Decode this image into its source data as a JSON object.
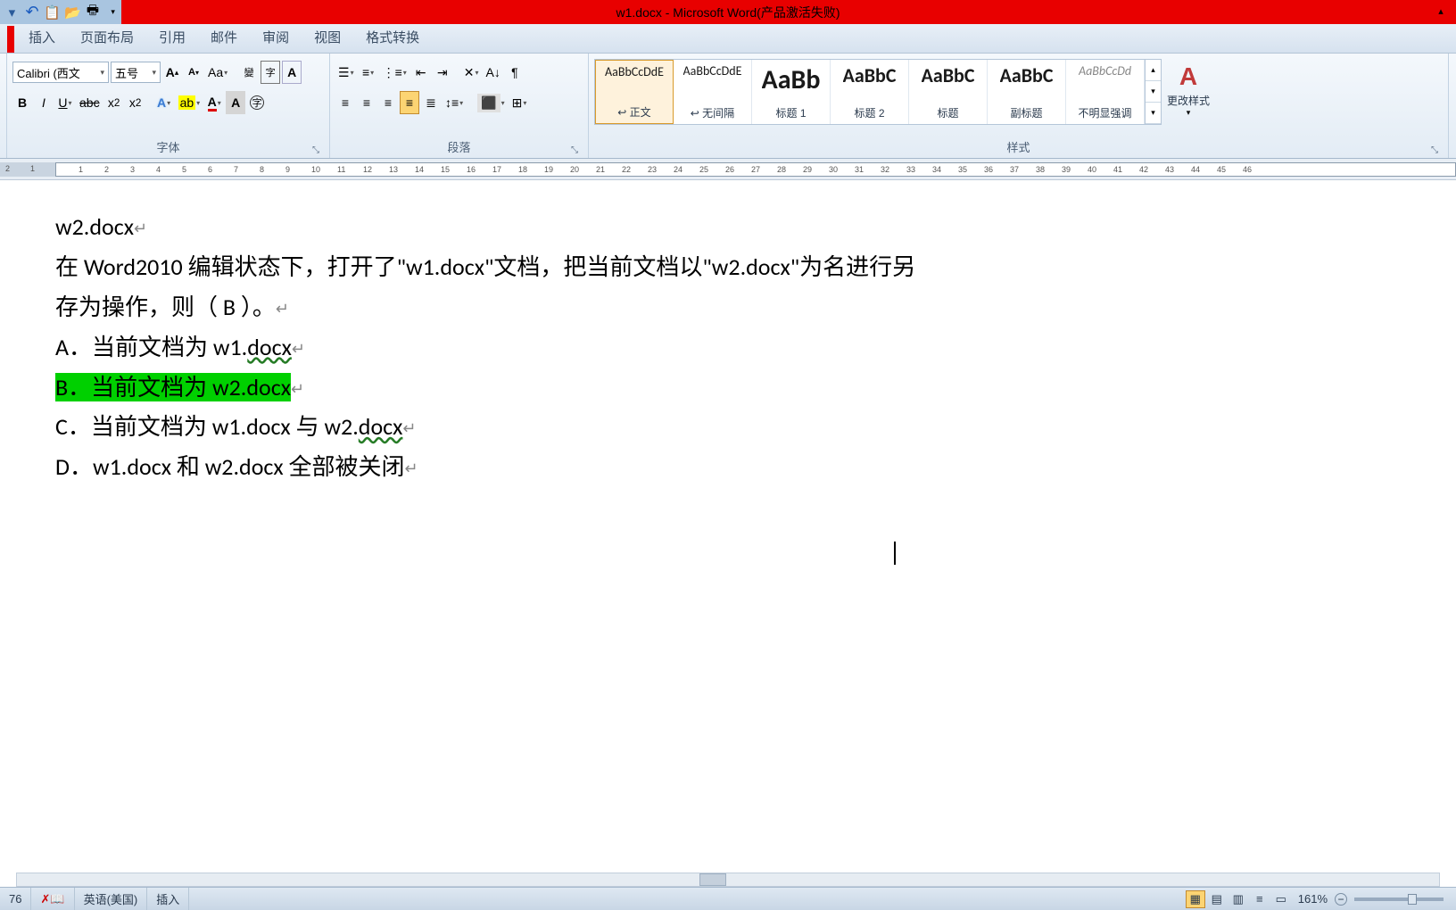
{
  "title": "w1.docx - Microsoft Word(产品激活失败)",
  "qat": [
    "undo",
    "redo",
    "open",
    "new"
  ],
  "ribbon_tabs": [
    "插入",
    "页面布局",
    "引用",
    "邮件",
    "审阅",
    "视图",
    "格式转换"
  ],
  "font_group": {
    "label": "字体",
    "font_name": "Calibri (西文",
    "font_size": "五号"
  },
  "para_group": {
    "label": "段落"
  },
  "styles_group": {
    "label": "样式",
    "items": [
      {
        "preview": "AaBbCcDdE",
        "label": "↩ 正文",
        "size": 14,
        "selected": true
      },
      {
        "preview": "AaBbCcDdE",
        "label": "↩ 无间隔",
        "size": 14
      },
      {
        "preview": "AaBb",
        "label": "标题 1",
        "size": 30
      },
      {
        "preview": "AaBbC",
        "label": "标题 2",
        "size": 22
      },
      {
        "preview": "AaBbC",
        "label": "标题",
        "size": 22
      },
      {
        "preview": "AaBbC",
        "label": "副标题",
        "size": 22
      },
      {
        "preview": "AaBbCcDd",
        "label": "不明显强调",
        "size": 14,
        "italic": true,
        "gray": true
      }
    ],
    "change_styles": "更改样式"
  },
  "ruler_numbers": [
    "2",
    "1",
    "",
    "1",
    "2",
    "3",
    "4",
    "5",
    "6",
    "7",
    "8",
    "9",
    "10",
    "11",
    "12",
    "13",
    "14",
    "15",
    "16",
    "17",
    "18",
    "19",
    "20",
    "21",
    "22",
    "23",
    "24",
    "25",
    "26",
    "27",
    "28",
    "29",
    "30",
    "31",
    "32",
    "33",
    "34",
    "35",
    "36",
    "37",
    "38",
    "39",
    "40",
    "41",
    "42",
    "43",
    "44",
    "45"
  ],
  "document": {
    "line1": "w2.docx",
    "question_a": "在 Word2010 编辑状态下，打开了\"w1.docx\"文档，把当前文档以\"w2.docx\"为名进行另",
    "question_b": "存为操作，则（  B  ）。",
    "opt_a": "A．当前文档为 w1.docx",
    "opt_b": "B．当前文档为 w2.docx",
    "opt_c": "C．当前文档为 w1.docx 与 w2.docx",
    "opt_d": "D．w1.docx 和 w2.docx 全部被关闭"
  },
  "status": {
    "page": "76",
    "lang": "英语(美国)",
    "mode": "插入",
    "zoom": "161%"
  }
}
